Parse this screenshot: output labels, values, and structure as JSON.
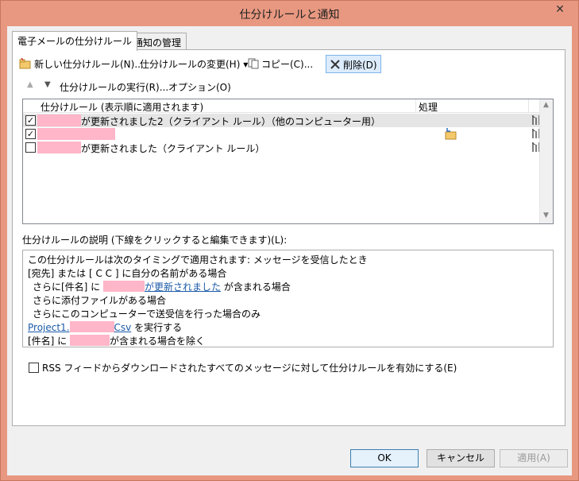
{
  "window": {
    "title": "仕分けルールと通知",
    "close": "✕"
  },
  "tabs": [
    {
      "label": "電子メールの仕分けルール",
      "active": true
    },
    {
      "label": "通知の管理",
      "active": false
    }
  ],
  "toolbar": {
    "new_rule": "新しい仕分けルール(N)...",
    "change_rule": "仕分けルールの変更(H)",
    "change_arrow": "▾",
    "copy": "コピー(C)...",
    "delete": "削除(D)"
  },
  "row2": {
    "up": "▲",
    "down": "▼",
    "run_rules": "仕分けルールの実行(R)...",
    "options": "オプション(O)"
  },
  "list": {
    "col_rule": "仕分けルール (表示順に適用されます)",
    "col_action": "処理",
    "rows": [
      {
        "checked": true,
        "checkmark": "✓",
        "text": "が更新されました2（クライアント ルール）（他のコンピューター用）"
      },
      {
        "checked": true,
        "checkmark": "✓",
        "text": ""
      },
      {
        "checked": false,
        "checkmark": "",
        "text": "が更新されました（クライアント ルール）"
      }
    ],
    "scroll_up": "▲",
    "scroll_down": "▼"
  },
  "description": {
    "label": "仕分けルールの説明 (下線をクリックすると編集できます)(L):",
    "line1": "この仕分けルールは次のタイミングで適用されます: メッセージを受信したとき",
    "line2": "[宛先] または [ C C ] に自分の名前がある場合",
    "line3_prefix": "さらに[件名] に",
    "line3_link": "が更新されました",
    "line3_suffix": "が含まれる場合",
    "line4": "さらに添付ファイルがある場合",
    "line5": "さらにこのコンピューターで送受信を行った場合のみ",
    "line6_link_a": "Project1.",
    "line6_link_b": "Csv",
    "line6_suffix": "を実行する",
    "line7_prefix": "[件名] に",
    "line7_suffix": "が含まれる場合を除く"
  },
  "rss": {
    "label": "RSS フィードからダウンロードされたすべてのメッセージに対して仕分けルールを有効にする(E)"
  },
  "buttons": {
    "ok": "OK",
    "cancel": "キャンセル",
    "apply": "適用(A)"
  },
  "colors": {
    "frame": "#e89880",
    "masked": "#ffb6c8",
    "link": "#1a5aa8"
  }
}
